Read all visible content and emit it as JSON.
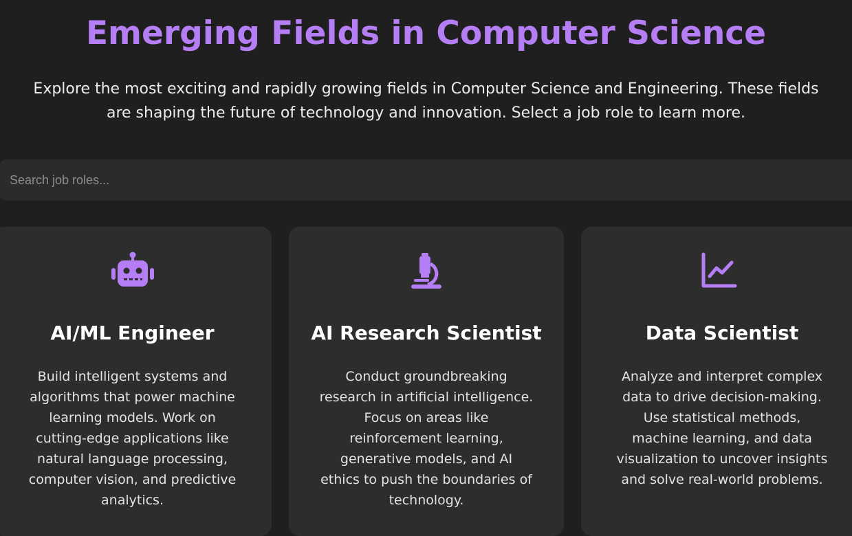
{
  "header": {
    "title": "Emerging Fields in Computer Science",
    "intro_lines": [
      "Explore the most exciting and rapidly growing fields in Computer Science and Engineering. These fields",
      "are shaping the future of technology and innovation. Select a job role to learn more."
    ]
  },
  "search": {
    "placeholder": "Search job roles...",
    "value": ""
  },
  "colors": {
    "accent": "#b67ef4",
    "background": "#1f1f1f",
    "card": "#2d2d2d"
  },
  "cards": [
    {
      "icon": "robot-icon",
      "title": "AI/ML Engineer",
      "desc_lines": [
        "Build intelligent systems and",
        "algorithms that power machine",
        "learning models. Work on",
        "cutting-edge applications like",
        "natural language processing,",
        "computer vision, and predictive",
        "analytics."
      ]
    },
    {
      "icon": "microscope-icon",
      "title": "AI Research Scientist",
      "desc_lines": [
        "Conduct groundbreaking",
        "research in artificial intelligence.",
        "Focus on areas like",
        "reinforcement learning,",
        "generative models, and AI",
        "ethics to push the boundaries of",
        "technology."
      ]
    },
    {
      "icon": "line-chart-icon",
      "title": "Data Scientist",
      "desc_lines": [
        "Analyze and interpret complex",
        "data to drive decision-making.",
        "Use statistical methods,",
        "machine learning, and data",
        "visualization to uncover insights",
        "and solve real-world problems."
      ]
    }
  ]
}
